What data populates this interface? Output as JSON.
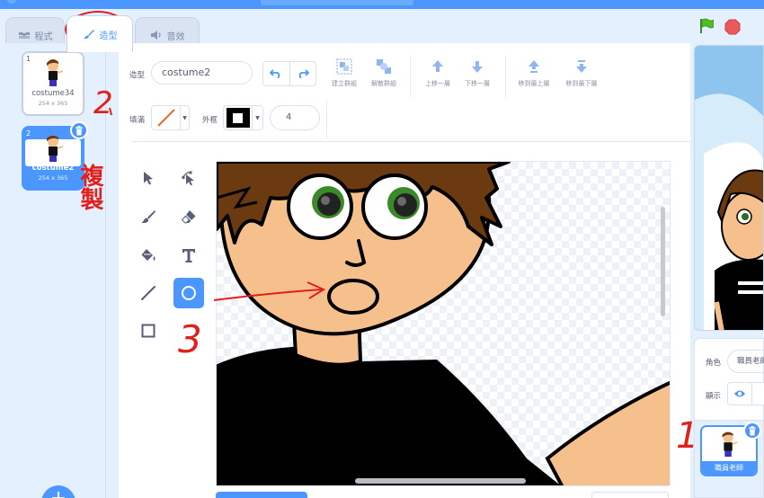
{
  "tabs": [
    {
      "label": "程式",
      "icon": "code-icon"
    },
    {
      "label": "造型",
      "icon": "brush-icon"
    },
    {
      "label": "音效",
      "icon": "speaker-icon"
    }
  ],
  "costumes": [
    {
      "num": "1",
      "name": "costume34",
      "size": "254 x 365"
    },
    {
      "num": "2",
      "name": "costume2",
      "size": "254 x 365"
    }
  ],
  "editor": {
    "costume_label": "造型",
    "costume_name": "costume2",
    "group": "建立群組",
    "ungroup": "解散群組",
    "forward": "上移一層",
    "backward": "下移一層",
    "front": "移到最上層",
    "back": "移到最下層",
    "fill_label": "填滿",
    "outline_label": "外框",
    "outline_width": "4",
    "fill_color": "#e66a2c",
    "outline_color": "#000000"
  },
  "sprite": {
    "label": "角色",
    "name": "職員老師",
    "show_label": "顯示",
    "card_name": "職員老師"
  },
  "annotations": {
    "step1": "1",
    "step2": "2",
    "step2_text": "複製",
    "step3": "3"
  },
  "colors": {
    "accent": "#4c97ff",
    "annotation": "#e0201c",
    "skin": "#f6c08c",
    "hair": "#6b3a10"
  }
}
